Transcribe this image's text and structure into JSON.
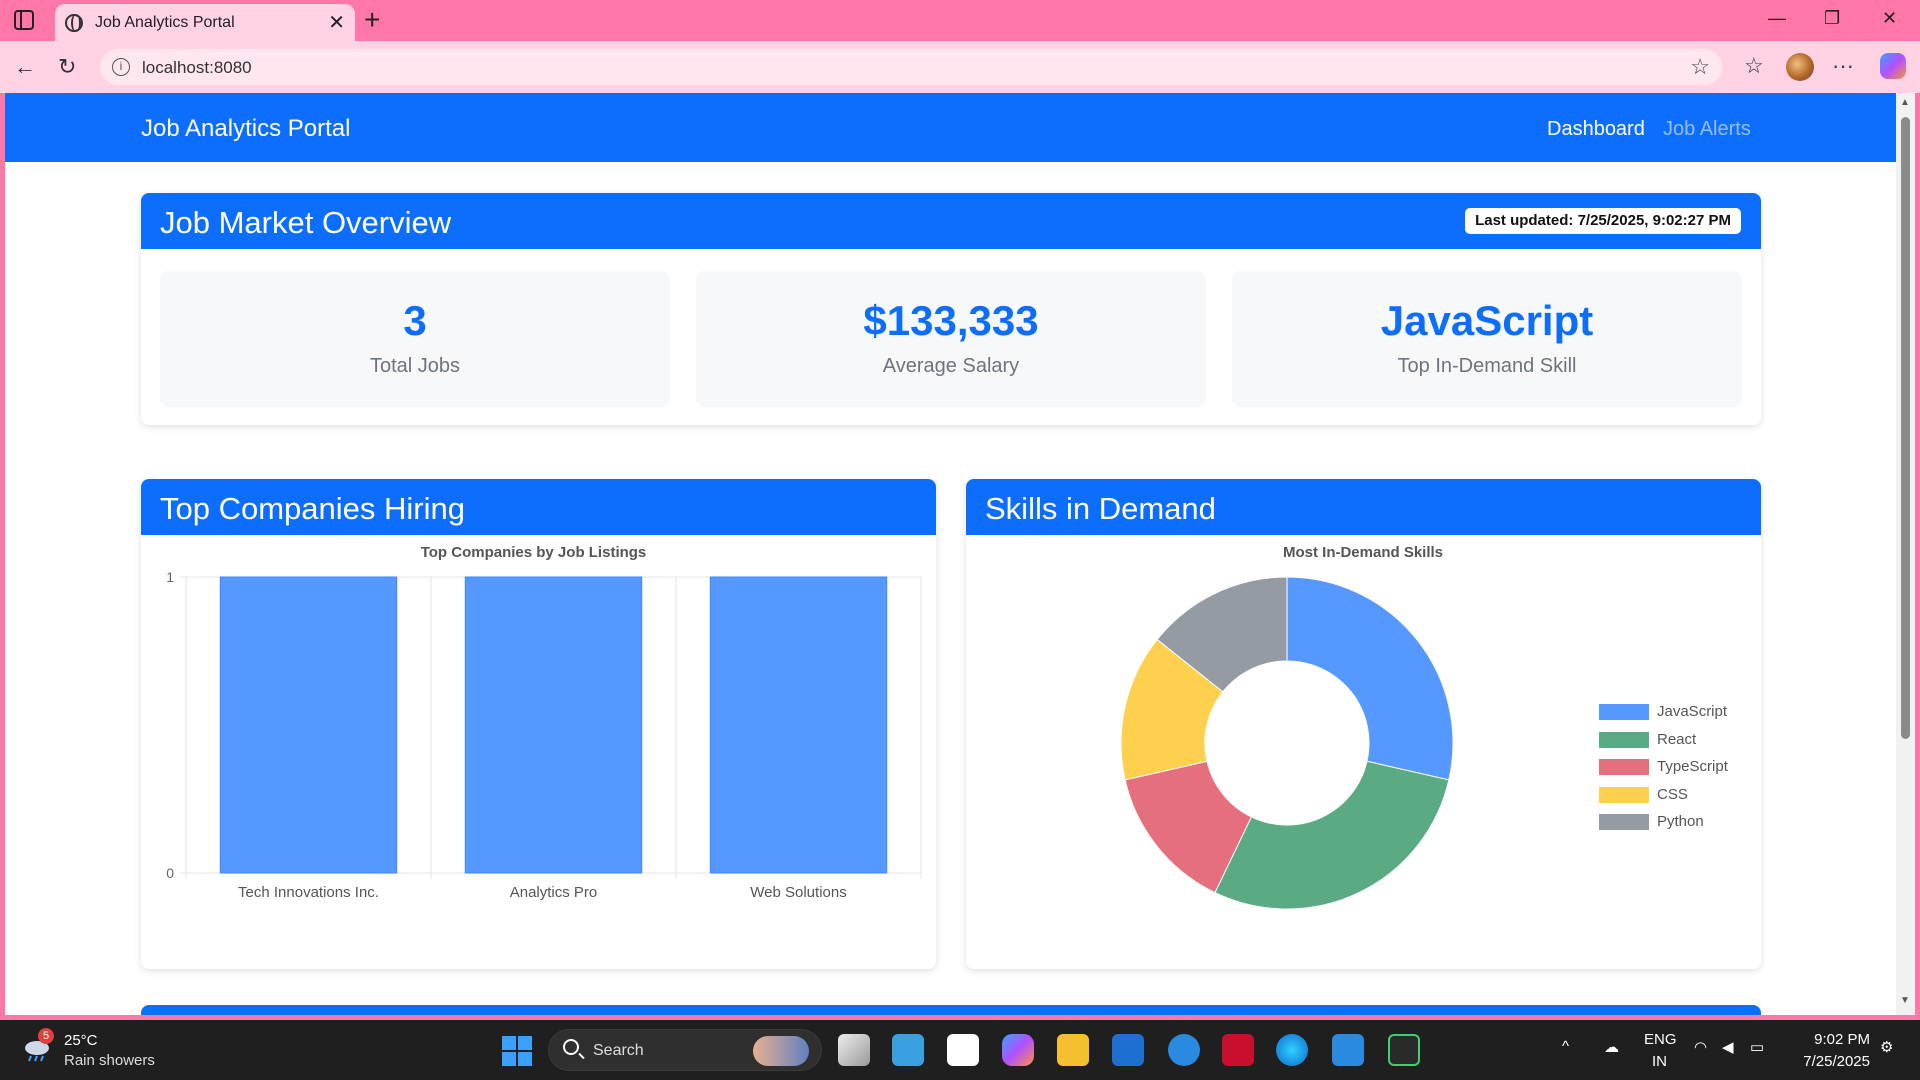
{
  "browser": {
    "tab_title": "Job Analytics Portal",
    "tab_close": "✕",
    "new_tab": "+",
    "url": "localhost:8080",
    "minimize": "—",
    "restore": "❐",
    "close": "✕",
    "back": "←",
    "refresh": "↻",
    "star": "☆",
    "favorites": "☆",
    "more": "···"
  },
  "app": {
    "brand": "Job Analytics Portal",
    "nav": [
      {
        "label": "Dashboard",
        "active": true
      },
      {
        "label": "Job Alerts",
        "active": false
      }
    ],
    "accent_color": "#0d6efd"
  },
  "overview": {
    "title": "Job Market Overview",
    "last_updated": "Last updated: 7/25/2025, 9:02:27 PM",
    "stats": [
      {
        "value": "3",
        "label": "Total Jobs"
      },
      {
        "value": "$133,333",
        "label": "Average Salary"
      },
      {
        "value": "JavaScript",
        "label": "Top In-Demand Skill"
      }
    ]
  },
  "companies_card": {
    "title": "Top Companies Hiring"
  },
  "skills_card": {
    "title": "Skills in Demand"
  },
  "chart_data": [
    {
      "type": "bar",
      "title": "Top Companies by Job Listings",
      "categories": [
        "Tech Innovations Inc.",
        "Analytics Pro",
        "Web Solutions"
      ],
      "values": [
        1,
        1,
        1
      ],
      "ylim": [
        0,
        1
      ],
      "yticks": [
        "0",
        "1"
      ],
      "color": "#5598ff",
      "grid": true,
      "legend": "none"
    },
    {
      "type": "pie",
      "title": "Most In-Demand Skills",
      "categories": [
        "JavaScript",
        "React",
        "TypeScript",
        "CSS",
        "Python"
      ],
      "values": [
        2,
        2,
        1,
        1,
        1
      ],
      "colors": [
        "#5598ff",
        "#5aab84",
        "#e66f7d",
        "#ffd04e",
        "#959ba3"
      ],
      "legend": "right"
    }
  ],
  "taskbar": {
    "weather_badge": "5",
    "temperature": "25°C",
    "weather": "Rain showers",
    "search_label": "Search",
    "language": "ENG",
    "region": "IN",
    "time": "9:02 PM",
    "date": "7/25/2025",
    "tray_chevron": "^"
  }
}
